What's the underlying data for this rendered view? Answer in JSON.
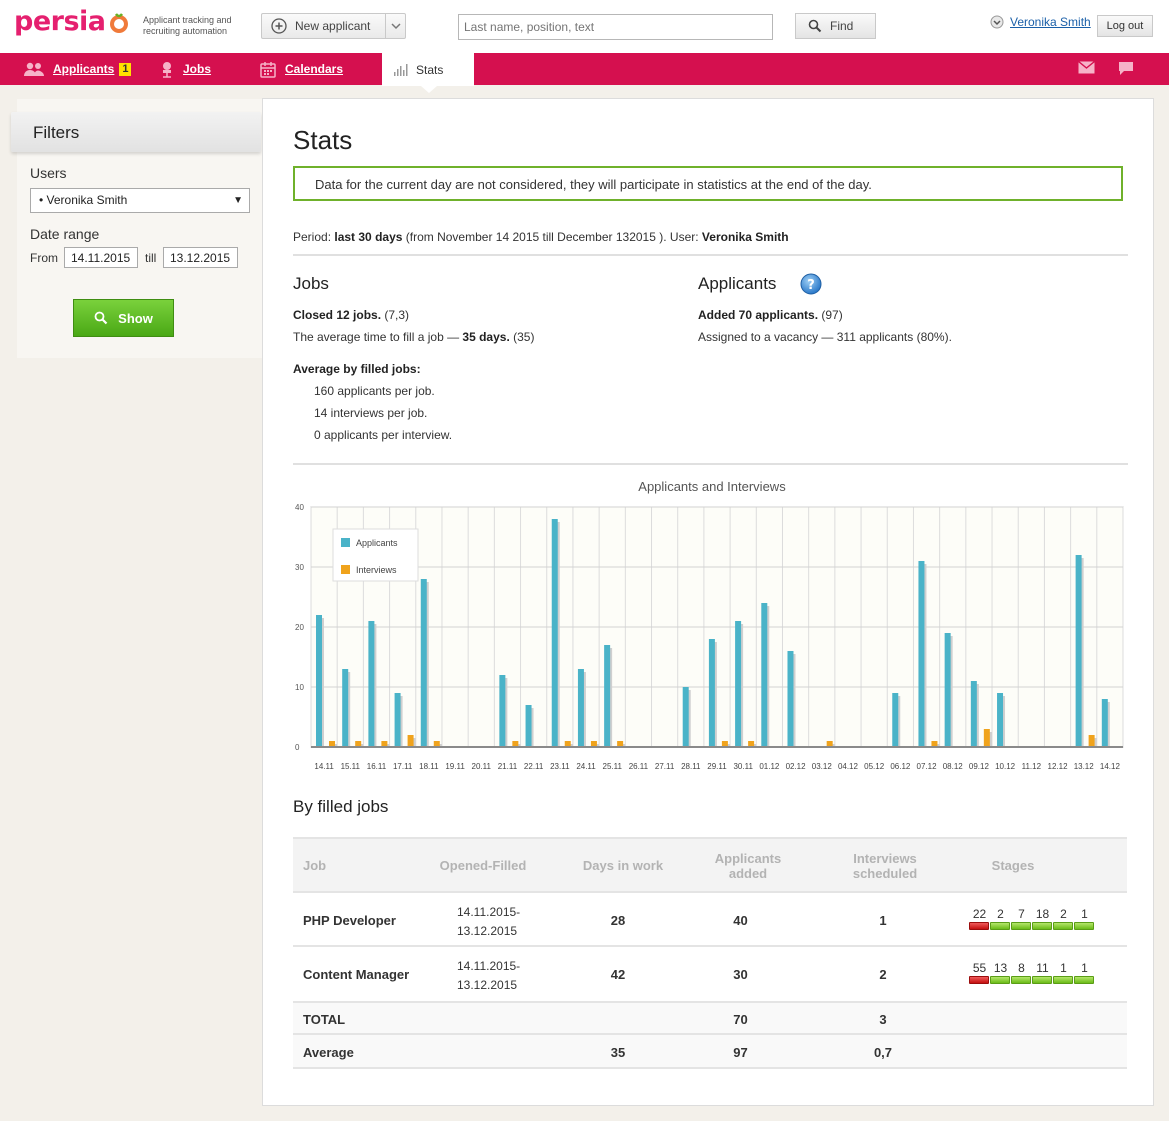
{
  "app": {
    "logo": "persia",
    "tagline_line1": "Applicant tracking and",
    "tagline_line2": "recruiting automation"
  },
  "header": {
    "new_applicant": "New applicant",
    "search_placeholder": "Last name, position, text",
    "find": "Find",
    "user_name": "Veronika Smith",
    "logout": "Log out"
  },
  "nav": {
    "applicants": "Applicants",
    "applicants_badge": "1",
    "jobs": "Jobs",
    "calendars": "Calendars",
    "stats": "Stats",
    "accent": "#d5104f"
  },
  "filters": {
    "title": "Filters",
    "users_label": "Users",
    "user_selected": "• Veronika Smith",
    "date_range_label": "Date range",
    "from_label": "From",
    "from_value": "14.11.2015",
    "till_label": "till",
    "till_value": "13.12.2015",
    "show": "Show"
  },
  "stats": {
    "title": "Stats",
    "notice": "Data for the current day are not considered, they will participate in statistics at the end of the day.",
    "period_label": "Period:",
    "period_value": "last 30 days",
    "period_range": "(from November 14 2015 till December 132015 ).",
    "user_label": "User:",
    "user_value": "Veronika Smith"
  },
  "jobs": {
    "title": "Jobs",
    "closed_label": "Closed 12 jobs.",
    "closed_prev": "(7,3)",
    "avg_time_prefix": "The average time to fill a job —",
    "avg_time_value": "35 days.",
    "avg_time_prev": "(35)",
    "avg_filled_label": "Average by filled jobs:",
    "avg_lines": [
      "160 applicants per job.",
      "14 interviews per job.",
      "0 applicants per interview."
    ]
  },
  "applicants": {
    "title": "Applicants",
    "added_label": "Added 70 applicants.",
    "added_prev": "(97)",
    "assigned": "Assigned to a vacancy — 311 applicants (80%)."
  },
  "chart_data": {
    "type": "bar",
    "title": "Applicants and Interviews",
    "xlabel": "",
    "ylabel": "",
    "ylim": [
      0,
      40
    ],
    "yticks": [
      0,
      10,
      20,
      30,
      40
    ],
    "grid": true,
    "legend_position": "top-left",
    "categories": [
      "14.11",
      "15.11",
      "16.11",
      "17.11",
      "18.11",
      "19.11",
      "20.11",
      "21.11",
      "22.11",
      "23.11",
      "24.11",
      "25.11",
      "26.11",
      "27.11",
      "28.11",
      "29.11",
      "30.11",
      "01.12",
      "02.12",
      "03.12",
      "04.12",
      "05.12",
      "06.12",
      "07.12",
      "08.12",
      "09.12",
      "10.12",
      "11.12",
      "12.12",
      "13.12",
      "14.12"
    ],
    "series": [
      {
        "name": "Applicants",
        "color": "#4ab3c8",
        "values": [
          22,
          13,
          21,
          9,
          28,
          0,
          0,
          12,
          7,
          38,
          13,
          17,
          0,
          0,
          10,
          18,
          21,
          24,
          16,
          0,
          0,
          0,
          9,
          31,
          19,
          11,
          9,
          0,
          0,
          32,
          8
        ]
      },
      {
        "name": "Interviews",
        "color": "#f0a31c",
        "values": [
          1,
          1,
          1,
          2,
          1,
          0,
          0,
          1,
          0,
          1,
          1,
          1,
          0,
          0,
          0,
          1,
          1,
          0,
          0,
          1,
          0,
          0,
          0,
          1,
          0,
          3,
          0,
          0,
          0,
          2,
          0
        ]
      }
    ]
  },
  "filled": {
    "title": "By filled jobs",
    "headers": {
      "job": "Job",
      "opened": "Opened-Filled",
      "days": "Days in work",
      "apps1": "Applicants",
      "apps2": "added",
      "ints1": "Interviews",
      "ints2": "scheduled",
      "stages": "Stages"
    },
    "rows": [
      {
        "job": "PHP Developer",
        "from": "14.11.2015-",
        "to": "13.12.2015",
        "days": "28",
        "apps": "40",
        "ints": "1",
        "stages": [
          "22",
          "2",
          "7",
          "18",
          "2",
          "1"
        ]
      },
      {
        "job": "Content Manager",
        "from": "14.11.2015-",
        "to": "13.12.2015",
        "days": "42",
        "apps": "30",
        "ints": "2",
        "stages": [
          "55",
          "13",
          "8",
          "11",
          "1",
          "1"
        ]
      }
    ],
    "total": {
      "label": "TOTAL",
      "apps": "70",
      "ints": "3"
    },
    "average": {
      "label": "Average",
      "days": "35",
      "apps": "97",
      "ints": "0,7"
    }
  }
}
